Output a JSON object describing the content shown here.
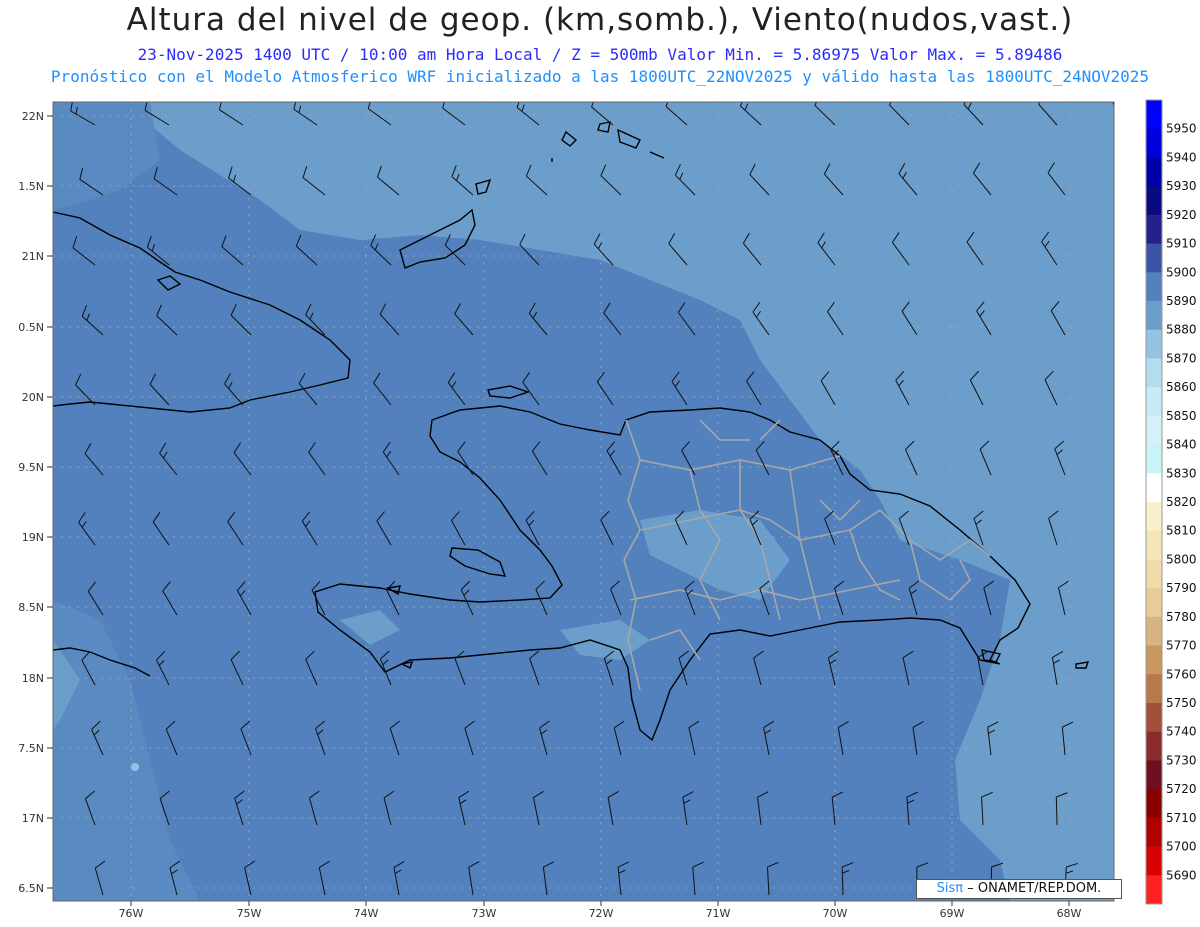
{
  "header": {
    "title": "Altura del nivel de geop. (km,somb.), Viento(nudos,vast.)",
    "line1": "23-Nov-2025  1400 UTC / 10:00 am Hora Local / Z = 500mb   Valor Min. = 5.86975  Valor Max. = 5.89486",
    "line2": "Pronóstico con el Modelo Atmosferico WRF inicializado a las 1800UTC_22NOV2025 y válido hasta las  1800UTC_24NOV2025"
  },
  "map": {
    "region": "Hispaniola",
    "lat_labels": [
      "22N",
      "1.5N",
      "21N",
      "0.5N",
      "20N",
      "9.5N",
      "19N",
      "8.5N",
      "18N",
      "7.5N",
      "17N",
      "6.5N"
    ],
    "lon_labels": [
      "76W",
      "75W",
      "74W",
      "73W",
      "72W",
      "71W",
      "70W",
      "69W",
      "68W"
    ],
    "shading_colors": {
      "dark": "#4e80bb",
      "light": "#6a9dcb",
      "lightest": "#8fbde0"
    }
  },
  "colorbar": {
    "levels": [
      "5950",
      "5940",
      "5930",
      "5920",
      "5910",
      "5900",
      "5890",
      "5880",
      "5870",
      "5860",
      "5850",
      "5840",
      "5830",
      "5820",
      "5810",
      "5800",
      "5790",
      "5780",
      "5770",
      "5760",
      "5750",
      "5740",
      "5730",
      "5720",
      "5710",
      "5700",
      "5690"
    ],
    "colors": [
      "#0000ff",
      "#0000dd",
      "#0000aa",
      "#0a0a80",
      "#22228a",
      "#3a54a6",
      "#5281bd",
      "#6c9ecb",
      "#94c3e3",
      "#b4dcef",
      "#c8eaf4",
      "#d5f0f8",
      "#c8f4f8",
      "#ffffff",
      "#f9f0cc",
      "#f5e6b8",
      "#efdcaa",
      "#e8cc98",
      "#d8b482",
      "#c8985e",
      "#b8784a",
      "#a2503a",
      "#8a2a2c",
      "#6e1020",
      "#8a0000",
      "#b00000",
      "#d80000",
      "#ff2020"
    ]
  },
  "credit": {
    "brand": "Sisπ",
    "text": "– ONAMET/REP.DOM."
  }
}
